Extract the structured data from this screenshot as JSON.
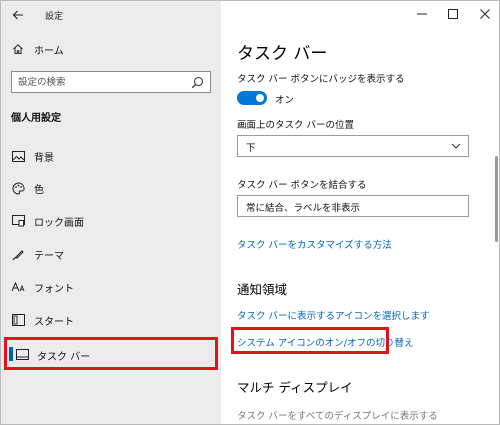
{
  "window": {
    "app_title": "設定",
    "controls": {
      "minimize": "minimize-icon",
      "maximize": "maximize-icon",
      "close": "close-icon"
    }
  },
  "sidebar": {
    "home_label": "ホーム",
    "search_placeholder": "設定の検索",
    "section_title": "個人用設定",
    "items": [
      {
        "label": "背景",
        "icon": "image-icon"
      },
      {
        "label": "色",
        "icon": "palette-icon"
      },
      {
        "label": "ロック画面",
        "icon": "lock-screen-icon"
      },
      {
        "label": "テーマ",
        "icon": "theme-icon"
      },
      {
        "label": "フォント",
        "icon": "font-icon"
      },
      {
        "label": "スタート",
        "icon": "start-icon"
      },
      {
        "label": "タスク バー",
        "icon": "taskbar-icon",
        "selected": true
      }
    ]
  },
  "main": {
    "title": "タスク バー",
    "badge_setting": {
      "label": "タスク バー ボタンにバッジを表示する",
      "state": "オン",
      "on": true
    },
    "position_setting": {
      "label": "画面上のタスク バーの位置",
      "value": "下"
    },
    "combine_setting": {
      "label": "タスク バー ボタンを結合する",
      "value": "常に結合、ラベルを非表示"
    },
    "customize_link": "タスク バーをカスタマイズする方法",
    "notification_section": {
      "title": "通知領域",
      "select_icons_link": "タスク バーに表示するアイコンを選択します",
      "system_icons_link": "システム アイコンのオン/オフの切り替え"
    },
    "multi_display_section": {
      "title": "マルチ ディスプレイ",
      "all_displays_label": "タスク バーをすべてのディスプレイに表示する"
    }
  },
  "colors": {
    "accent": "#0078d7",
    "link": "#0067c0",
    "highlight": "#e8101a"
  }
}
